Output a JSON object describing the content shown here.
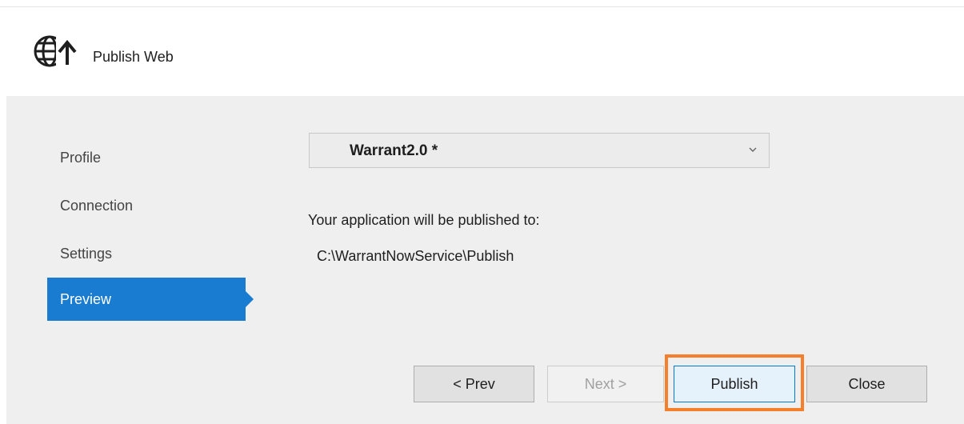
{
  "window": {
    "title": "Publish Web",
    "icon": "globe-upload-icon"
  },
  "nav": {
    "items": [
      {
        "label": "Profile",
        "active": false
      },
      {
        "label": "Connection",
        "active": false
      },
      {
        "label": "Settings",
        "active": false
      },
      {
        "label": "Preview",
        "active": true
      }
    ]
  },
  "profile_select": {
    "value": "Warrant2.0 *",
    "icon": "chevron-down-icon"
  },
  "preview": {
    "label": "Your application will be published to:",
    "path": "C:\\WarrantNowService\\Publish"
  },
  "buttons": {
    "prev": "< Prev",
    "next": "Next >",
    "publish": "Publish",
    "close": "Close"
  },
  "colors": {
    "accent": "#1a7cd0",
    "highlight": "#f57f2a",
    "panel": "#efefef"
  }
}
